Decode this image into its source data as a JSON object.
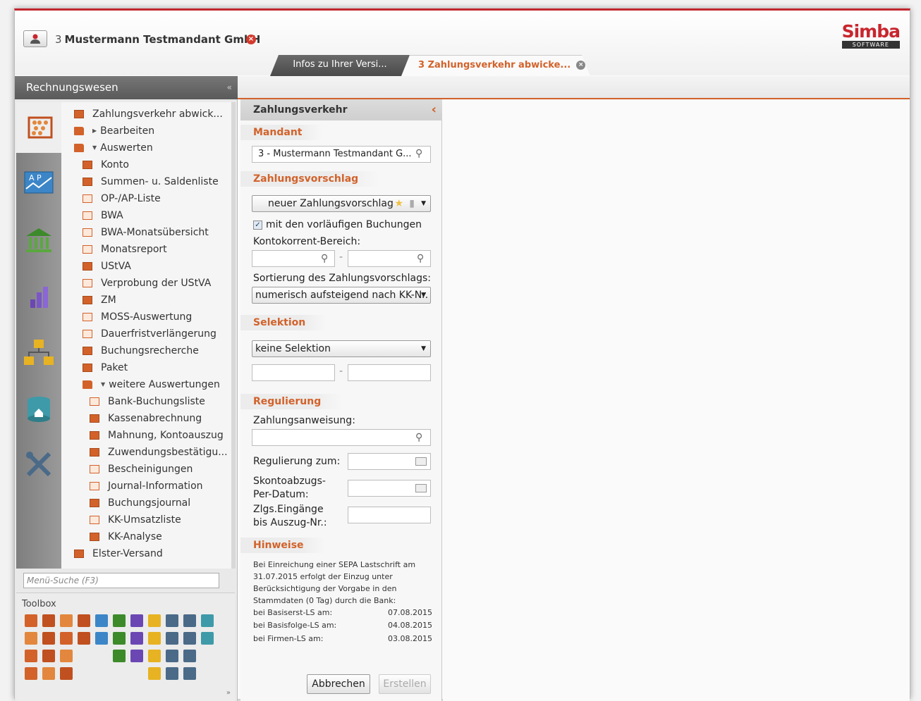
{
  "header": {
    "client_number": "3",
    "client_name": "Mustermann Testmandant GmbH",
    "logo_top": "Simba",
    "logo_bottom": "SOFTWARE"
  },
  "tabs": [
    {
      "label": "Infos zu Ihrer Versi..."
    },
    {
      "label": "3 Zahlungsverkehr abwicke..."
    }
  ],
  "section": {
    "title": "Rechnungswesen"
  },
  "menu": {
    "items": [
      {
        "label": "Zahlungsverkehr abwick..."
      },
      {
        "label": "Bearbeiten"
      },
      {
        "label": "Auswerten"
      },
      {
        "label": "Konto"
      },
      {
        "label": "Summen- u. Saldenliste"
      },
      {
        "label": "OP-/AP-Liste"
      },
      {
        "label": "BWA"
      },
      {
        "label": "BWA-Monatsübersicht"
      },
      {
        "label": "Monatsreport"
      },
      {
        "label": "UStVA"
      },
      {
        "label": "Verprobung der UStVA"
      },
      {
        "label": "ZM"
      },
      {
        "label": "MOSS-Auswertung"
      },
      {
        "label": "Dauerfristverlängerung"
      },
      {
        "label": "Buchungsrecherche"
      },
      {
        "label": "Paket"
      },
      {
        "label": "weitere Auswertungen"
      },
      {
        "label": "Bank-Buchungsliste"
      },
      {
        "label": "Kassenabrechnung"
      },
      {
        "label": "Mahnung, Kontoauszug"
      },
      {
        "label": "Zuwendungsbestätigu..."
      },
      {
        "label": "Bescheinigungen"
      },
      {
        "label": "Journal-Information"
      },
      {
        "label": "Buchungsjournal"
      },
      {
        "label": "KK-Umsatzliste"
      },
      {
        "label": "KK-Analyse"
      },
      {
        "label": "Elster-Versand"
      }
    ],
    "search_placeholder": "Menü-Suche (F3)",
    "toolbox_title": "Toolbox"
  },
  "panel": {
    "title": "Zahlungsverkehr",
    "mandant_label": "Mandant",
    "mandant_value": "3 - Mustermann Testmandant G...",
    "zahlungsvorschlag_label": "Zahlungsvorschlag",
    "zahlungsvorschlag_value": "neuer Zahlungsvorschlag",
    "checkbox_label": "mit den vorläufigen Buchungen",
    "kontokorrent_label": "Kontokorrent-Bereich:",
    "dash": "-",
    "sortierung_label": "Sortierung des Zahlungsvorschlags:",
    "sortierung_value": "numerisch aufsteigend nach KK-Nr.",
    "selektion_label": "Selektion",
    "selektion_value": "keine Selektion",
    "regulierung_label": "Regulierung",
    "zahlungsanweisung_label": "Zahlungsanweisung:",
    "regulierung_zum_label": "Regulierung zum:",
    "skonto_label_1": "Skontoabzugs-",
    "skonto_label_2": "Per-Datum:",
    "zlgs_label_1": "Zlgs.Eingänge",
    "zlgs_label_2": "bis Auszug-Nr.:",
    "hinweise_label": "Hinweise",
    "hint_text": "Bei Einreichung einer SEPA Lastschrift am 31.07.2015 erfolgt der Einzug unter Berücksichtigung der Vorgabe in den Stammdaten (0 Tag) durch die Bank:",
    "hint_rows": [
      {
        "label": "bei Basiserst-LS  am:",
        "value": "07.08.2015"
      },
      {
        "label": "bei Basisfolge-LS  am:",
        "value": "04.08.2015"
      },
      {
        "label": "bei Firmen-LS  am:",
        "value": "03.08.2015"
      }
    ],
    "cancel_label": "Abbrechen",
    "create_label": "Erstellen"
  },
  "colors": {
    "accent": "#d2622a",
    "brand_red": "#c8262e"
  }
}
